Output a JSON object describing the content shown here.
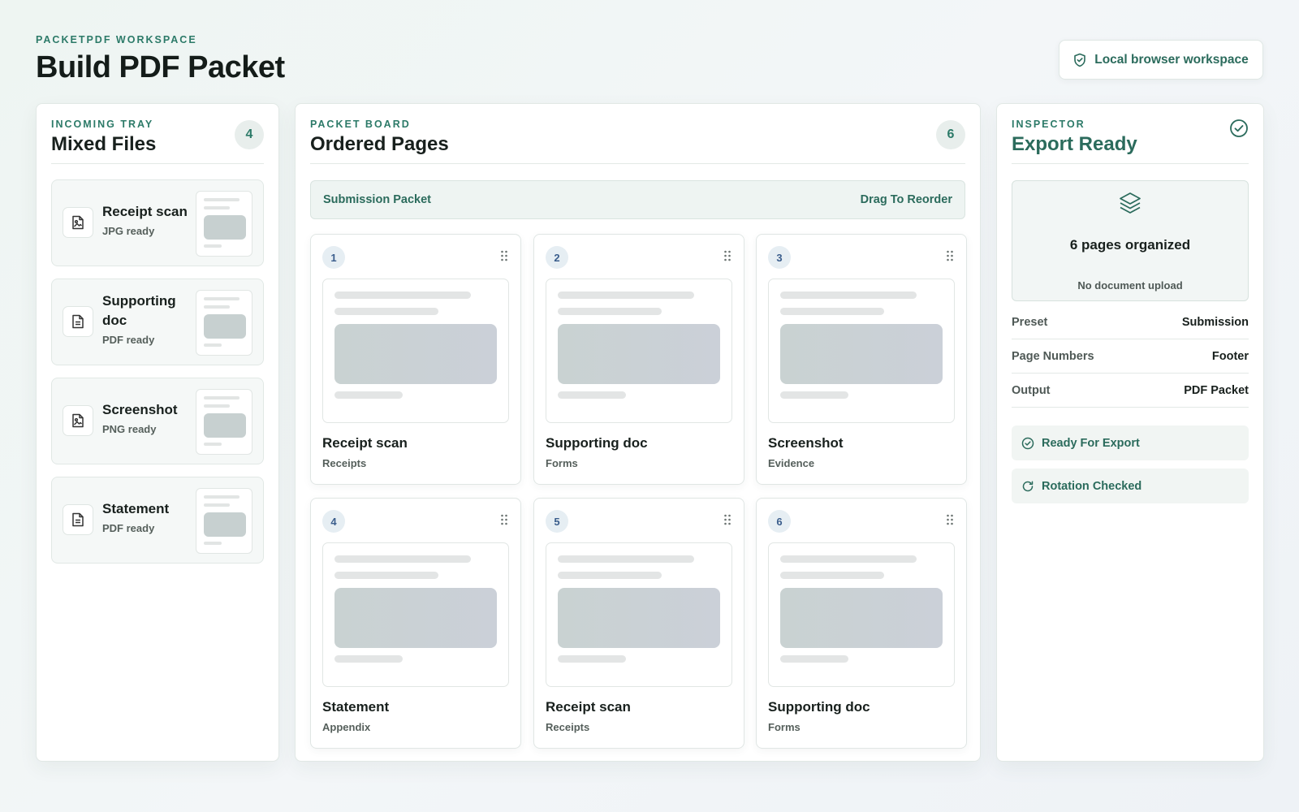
{
  "header": {
    "eyebrow": "PACKETPDF WORKSPACE",
    "title": "Build PDF Packet",
    "workspace_label": "Local browser workspace"
  },
  "tray": {
    "eyebrow": "INCOMING TRAY",
    "title": "Mixed Files",
    "count": "4",
    "items": [
      {
        "name": "Receipt scan",
        "status": "JPG ready",
        "icon": "image-file-icon"
      },
      {
        "name": "Supporting doc",
        "status": "PDF ready",
        "icon": "document-file-icon"
      },
      {
        "name": "Screenshot",
        "status": "PNG ready",
        "icon": "image-file-icon"
      },
      {
        "name": "Statement",
        "status": "PDF ready",
        "icon": "document-file-icon"
      }
    ]
  },
  "board": {
    "eyebrow": "PACKET BOARD",
    "title": "Ordered Pages",
    "count": "6",
    "packet_name": "Submission Packet",
    "reorder_hint": "Drag To Reorder",
    "pages": [
      {
        "num": "1",
        "name": "Receipt scan",
        "category": "Receipts"
      },
      {
        "num": "2",
        "name": "Supporting doc",
        "category": "Forms"
      },
      {
        "num": "3",
        "name": "Screenshot",
        "category": "Evidence"
      },
      {
        "num": "4",
        "name": "Statement",
        "category": "Appendix"
      },
      {
        "num": "5",
        "name": "Receipt scan",
        "category": "Receipts"
      },
      {
        "num": "6",
        "name": "Supporting doc",
        "category": "Forms"
      }
    ]
  },
  "inspector": {
    "eyebrow": "INSPECTOR",
    "title": "Export Ready",
    "summary_count": "6 pages organized",
    "summary_note": "No document upload",
    "props": [
      {
        "label": "Preset",
        "value": "Submission"
      },
      {
        "label": "Page Numbers",
        "value": "Footer"
      },
      {
        "label": "Output",
        "value": "PDF Packet"
      }
    ],
    "status": [
      {
        "label": "Ready For Export",
        "icon": "check-circle-icon"
      },
      {
        "label": "Rotation Checked",
        "icon": "rotate-icon"
      }
    ]
  },
  "colors": {
    "accent": "#2b6b5c",
    "accent_bright": "#2c7a68",
    "number_badge": "#3a5d8c"
  }
}
